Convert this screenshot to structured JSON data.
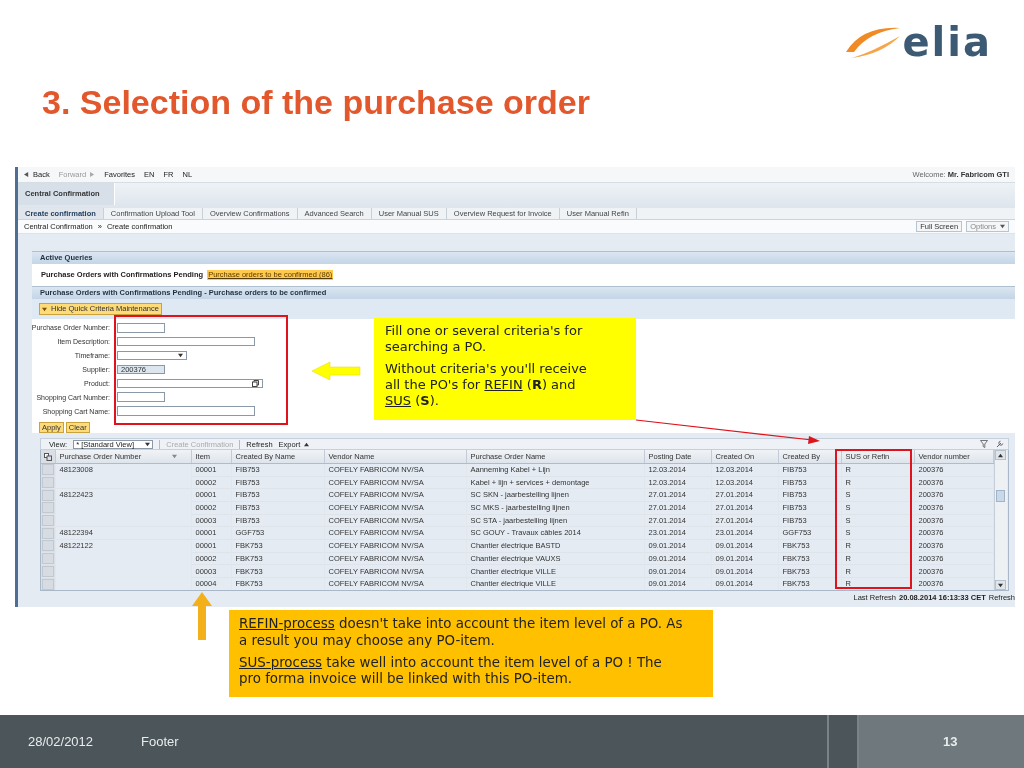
{
  "slide": {
    "title": "3. Selection of the purchase order",
    "logo": "elia",
    "footer": {
      "date": "28/02/2012",
      "text": "Footer",
      "page": "13"
    }
  },
  "app": {
    "nav": [
      {
        "label": "Back",
        "kind": "back",
        "disabled": false
      },
      {
        "label": "Forward",
        "kind": "forward",
        "disabled": true
      },
      {
        "label": "Favorites",
        "kind": "link",
        "disabled": false
      },
      {
        "label": "EN",
        "kind": "link",
        "disabled": false
      },
      {
        "label": "FR",
        "kind": "link",
        "disabled": false
      },
      {
        "label": "NL",
        "kind": "link",
        "disabled": false
      }
    ],
    "welcome": "Welcome:",
    "user": "Mr. Fabricom GTI",
    "header_tab": "Central Confirmation",
    "tabs": [
      {
        "label": "Create confirmation",
        "selected": true
      },
      {
        "label": "Confirmation Upload Tool",
        "selected": false
      },
      {
        "label": "Overview Confirmations",
        "selected": false
      },
      {
        "label": "Advanced Search",
        "selected": false
      },
      {
        "label": "User Manual SUS",
        "selected": false
      },
      {
        "label": "Overview Request for Invoice",
        "selected": false
      },
      {
        "label": "User Manual Refin",
        "selected": false
      }
    ],
    "breadcrumb": [
      "Central Confirmation",
      "Create confirmation"
    ],
    "breadcrumb_separator": "»",
    "header_buttons": [
      {
        "label": "Full Screen",
        "kind": "plain"
      },
      {
        "label": "Options",
        "kind": "menu"
      }
    ],
    "active_queries": {
      "title": "Active Queries",
      "query_label": "Purchase Orders with Confirmations Pending",
      "query_link": "Purchase orders to be confirmed (86)"
    },
    "section_title": "Purchase Orders with Confirmations Pending - Purchase orders to be confirmed",
    "toggle_button": "Hide Quick Criteria Maintenance",
    "criteria": [
      {
        "label": "Purchase Order Number:",
        "kind": "number",
        "disabled": false
      },
      {
        "label": "Item Description:",
        "kind": "text",
        "disabled": false
      },
      {
        "label": "Timeframe:",
        "kind": "select",
        "disabled": false
      },
      {
        "label": "Supplier:",
        "kind": "number",
        "value": "200376",
        "disabled": true
      },
      {
        "label": "Product:",
        "kind": "lookup",
        "disabled": false
      },
      {
        "label": "Shopping Cart Number:",
        "kind": "number",
        "disabled": false
      },
      {
        "label": "Shopping Cart Name:",
        "kind": "text",
        "disabled": false
      }
    ],
    "criteria_buttons": [
      "Apply",
      "Clear"
    ],
    "toolbar": {
      "view_label": "View:",
      "view": "* [Standard View]",
      "items": [
        {
          "label": "Create Confirmation",
          "kind": "button",
          "disabled": true
        },
        {
          "label": "Refresh",
          "kind": "button",
          "disabled": false
        },
        {
          "label": "Export",
          "kind": "menu",
          "disabled": false
        }
      ]
    },
    "table": {
      "columns": [
        "Purchase Order Number",
        "Item",
        "Created By Name",
        "Vendor Name",
        "Purchase Order Name",
        "Posting Date",
        "Created On",
        "Created By",
        "SUS or Refin",
        "Vendor number"
      ],
      "rows": [
        {
          "cells": [
            "48123008",
            "00001",
            "FIB753",
            "COFELY FABRICOM NV/SA",
            "Aanneming Kabel + Lijn",
            "12.03.2014",
            "12.03.2014",
            "FIB753",
            "R",
            "200376"
          ]
        },
        {
          "cells": [
            "",
            "00002",
            "FIB753",
            "COFELY FABRICOM NV/SA",
            "Kabel + lijn + services + demontage",
            "12.03.2014",
            "12.03.2014",
            "FIB753",
            "R",
            "200376"
          ]
        },
        {
          "cells": [
            "48122423",
            "00001",
            "FIB753",
            "COFELY FABRICOM NV/SA",
            "SC SKN - jaarbestelling lijnen",
            "27.01.2014",
            "27.01.2014",
            "FIB753",
            "S",
            "200376"
          ]
        },
        {
          "cells": [
            "",
            "00002",
            "FIB753",
            "COFELY FABRICOM NV/SA",
            "SC MKS - jaarbestelling lijnen",
            "27.01.2014",
            "27.01.2014",
            "FIB753",
            "S",
            "200376"
          ]
        },
        {
          "cells": [
            "",
            "00003",
            "FIB753",
            "COFELY FABRICOM NV/SA",
            "SC STA - jaarbestelling lijnen",
            "27.01.2014",
            "27.01.2014",
            "FIB753",
            "S",
            "200376"
          ]
        },
        {
          "cells": [
            "48122394",
            "00001",
            "GGF753",
            "COFELY FABRICOM NV/SA",
            "SC GOUY - Travaux câbles 2014",
            "23.01.2014",
            "23.01.2014",
            "GGF753",
            "S",
            "200376"
          ]
        },
        {
          "cells": [
            "48122122",
            "00001",
            "FBK753",
            "COFELY FABRICOM NV/SA",
            "Chantier électrique BASTD",
            "09.01.2014",
            "09.01.2014",
            "FBK753",
            "R",
            "200376"
          ]
        },
        {
          "cells": [
            "",
            "00002",
            "FBK753",
            "COFELY FABRICOM NV/SA",
            "Chantier électrique VAUXS",
            "09.01.2014",
            "09.01.2014",
            "FBK753",
            "R",
            "200376"
          ]
        },
        {
          "cells": [
            "",
            "00003",
            "FBK753",
            "COFELY FABRICOM NV/SA",
            "Chantier électrique VILLE",
            "09.01.2014",
            "09.01.2014",
            "FBK753",
            "R",
            "200376"
          ]
        },
        {
          "cells": [
            "",
            "00004",
            "FBK753",
            "COFELY FABRICOM NV/SA",
            "Chantier électrique VILLE",
            "09.01.2014",
            "09.01.2014",
            "FBK753",
            "R",
            "200376"
          ]
        }
      ]
    },
    "last_refresh": {
      "label": "Last Refresh",
      "time": "20.08.2014 16:13:33 CET",
      "link": "Refresh"
    }
  },
  "callouts": [
    {
      "kind": "yellow",
      "paragraphs": [
        [
          {
            "text": "Fill one or several criteria's for searching a PO.",
            "underline": false
          }
        ],
        [
          {
            "text": "Without criteria's you'll receive all the PO's for ",
            "underline": false
          },
          {
            "text": "REFIN",
            "underline": true
          },
          {
            "text": " (**R**) and ",
            "underline": false
          },
          {
            "text": "SUS",
            "underline": true
          },
          {
            "text": " (**S**).",
            "underline": false
          }
        ]
      ]
    },
    {
      "kind": "orange",
      "paragraphs": [
        [
          {
            "text": "REFIN-process",
            "underline": true
          },
          {
            "text": " doesn't take into account the item level of a PO. As a result you may choose any PO-item.",
            "underline": false
          }
        ],
        [
          {
            "text": "SUS-process",
            "underline": true
          },
          {
            "text": " take well into account the item level of a PO ! The pro forma invoice will be linked with this PO-item.",
            "underline": false
          }
        ]
      ]
    }
  ]
}
